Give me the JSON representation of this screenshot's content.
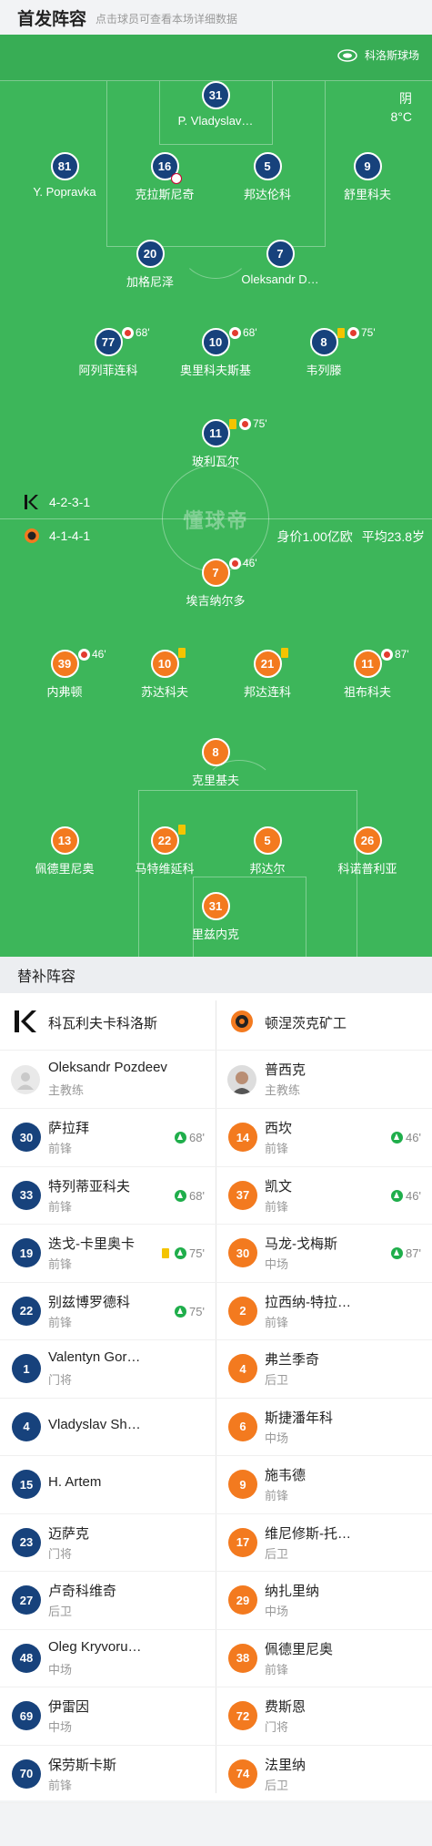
{
  "header": {
    "title": "首发阵容",
    "subtitle": "点击球员可查看本场详细数据"
  },
  "pitch": {
    "venue": "科洛斯球场",
    "weather": "阴",
    "temperature": "8°C",
    "watermark": "懂球帝",
    "home_formation": "4-2-3-1",
    "away_formation": "4-1-4-1",
    "team_value": "身价1.00亿欧",
    "avg_age": "平均23.8岁",
    "colors": {
      "pitch": "#3db65a",
      "home": "#17427c",
      "away": "#f37a1f"
    }
  },
  "home_players": [
    {
      "num": "31",
      "name": "P. Vladyslav…"
    },
    {
      "num": "81",
      "name": "Y. Popravka"
    },
    {
      "num": "16",
      "name": "克拉斯尼奇",
      "goal_icon": "football-icon"
    },
    {
      "num": "5",
      "name": "邦达伦科"
    },
    {
      "num": "9",
      "name": "舒里科夫"
    },
    {
      "num": "20",
      "name": "加格尼泽"
    },
    {
      "num": "7",
      "name": "Oleksandr D…"
    },
    {
      "num": "77",
      "name": "阿列菲连科",
      "sub": "68'"
    },
    {
      "num": "10",
      "name": "奥里科夫斯基",
      "sub": "68'"
    },
    {
      "num": "8",
      "name": "韦列滕",
      "sub": "75'",
      "yellow": true
    },
    {
      "num": "11",
      "name": "玻利瓦尔",
      "sub": "75'",
      "yellow": true
    }
  ],
  "away_players": [
    {
      "num": "7",
      "name": "埃吉纳尔多",
      "sub": "46'"
    },
    {
      "num": "39",
      "name": "内弗顿",
      "sub": "46'"
    },
    {
      "num": "10",
      "name": "苏达科夫",
      "yellow": true
    },
    {
      "num": "21",
      "name": "邦达连科",
      "yellow": true
    },
    {
      "num": "11",
      "name": "祖布科夫",
      "sub": "87'"
    },
    {
      "num": "8",
      "name": "克里基夫"
    },
    {
      "num": "13",
      "name": "佩德里尼奥"
    },
    {
      "num": "22",
      "name": "马特维延科",
      "yellow": true
    },
    {
      "num": "5",
      "name": "邦达尔"
    },
    {
      "num": "26",
      "name": "科诺普利亚"
    },
    {
      "num": "31",
      "name": "里兹内克"
    }
  ],
  "bench": {
    "title": "替补阵容",
    "home_team": "科瓦利夫卡科洛斯",
    "away_team": "顿涅茨克矿工",
    "home_coach": {
      "name": "Oleksandr Pozdeev",
      "role": "主教练"
    },
    "away_coach": {
      "name": "普西克",
      "role": "主教练"
    },
    "home_subs": [
      {
        "num": "30",
        "name": "萨拉拜",
        "pos": "前锋",
        "sub_in": "68'"
      },
      {
        "num": "33",
        "name": "特列蒂亚科夫",
        "pos": "前锋",
        "sub_in": "68'"
      },
      {
        "num": "19",
        "name": "迭戈-卡里奥卡",
        "pos": "前锋",
        "sub_in": "75'",
        "yellow": true
      },
      {
        "num": "22",
        "name": "别兹博罗德科",
        "pos": "前锋",
        "sub_in": "75'"
      },
      {
        "num": "1",
        "name": "Valentyn Gor…",
        "pos": "门将"
      },
      {
        "num": "4",
        "name": "Vladyslav Sh…",
        "pos": ""
      },
      {
        "num": "15",
        "name": "H. Artem",
        "pos": ""
      },
      {
        "num": "23",
        "name": "迈萨克",
        "pos": "门将"
      },
      {
        "num": "27",
        "name": "卢奇科维奇",
        "pos": "后卫"
      },
      {
        "num": "48",
        "name": "Oleg Kryvoru…",
        "pos": "中场"
      },
      {
        "num": "69",
        "name": "伊雷因",
        "pos": "中场"
      },
      {
        "num": "70",
        "name": "保劳斯卡斯",
        "pos": "前锋"
      }
    ],
    "away_subs": [
      {
        "num": "14",
        "name": "西坎",
        "pos": "前锋",
        "sub_in": "46'"
      },
      {
        "num": "37",
        "name": "凯文",
        "pos": "前锋",
        "sub_in": "46'"
      },
      {
        "num": "30",
        "name": "马龙-戈梅斯",
        "pos": "中场",
        "sub_in": "87'"
      },
      {
        "num": "2",
        "name": "拉西纳-特拉…",
        "pos": "前锋"
      },
      {
        "num": "4",
        "name": "弗兰季奇",
        "pos": "后卫"
      },
      {
        "num": "6",
        "name": "斯捷潘年科",
        "pos": "中场"
      },
      {
        "num": "9",
        "name": "施韦德",
        "pos": "前锋"
      },
      {
        "num": "17",
        "name": "维尼修斯-托…",
        "pos": "后卫"
      },
      {
        "num": "29",
        "name": "纳扎里纳",
        "pos": "中场"
      },
      {
        "num": "38",
        "name": "佩德里尼奥",
        "pos": "前锋"
      },
      {
        "num": "72",
        "name": "费斯恩",
        "pos": "门将"
      },
      {
        "num": "74",
        "name": "法里纳",
        "pos": "后卫"
      }
    ]
  }
}
